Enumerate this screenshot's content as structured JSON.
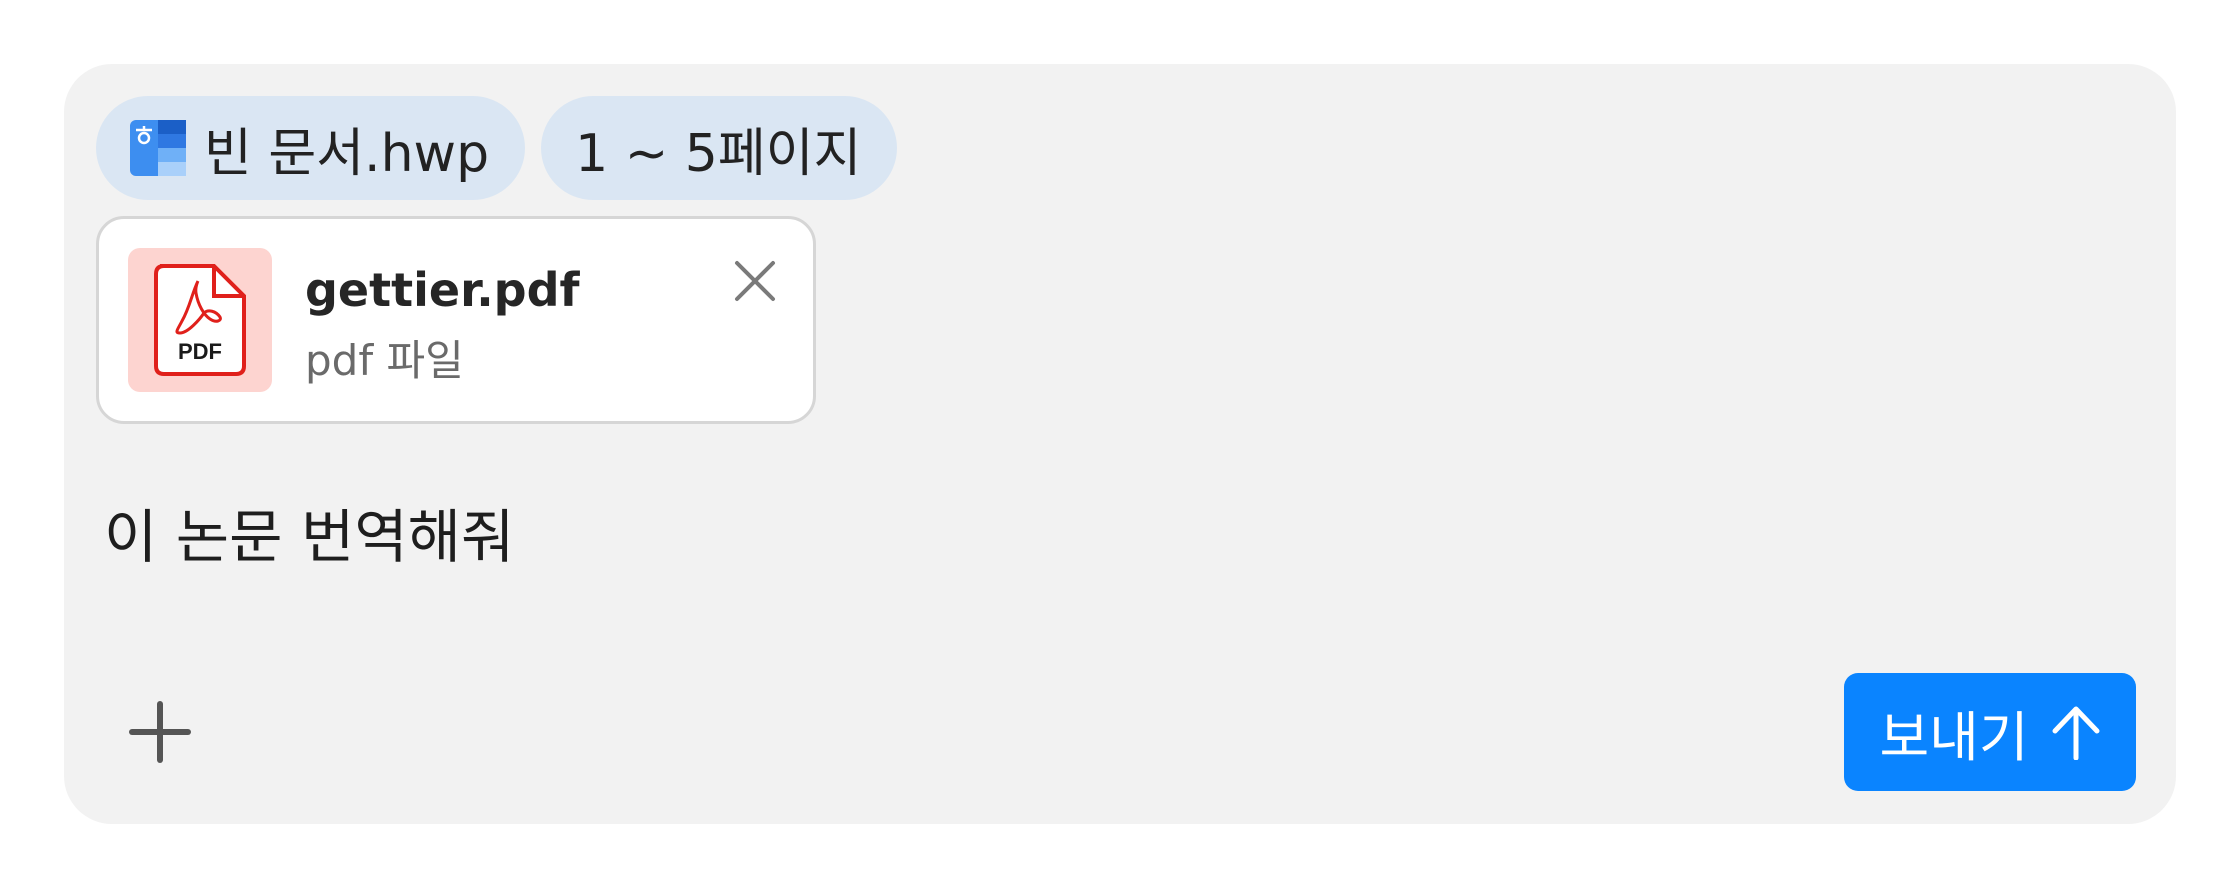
{
  "chips": [
    {
      "label": "빈 문서.hwp",
      "icon": "hwp-document-icon"
    },
    {
      "label": "1 ~ 5페이지"
    }
  ],
  "attachment": {
    "name": "gettier.pdf",
    "type_label": "pdf 파일",
    "icon": "pdf-file-icon",
    "icon_text": "PDF",
    "close_icon": "close-icon"
  },
  "message": {
    "text": "이 논문 번역해줘"
  },
  "toolbar": {
    "add_icon": "plus-icon",
    "send_label": "보내기",
    "send_icon": "arrow-up-icon"
  },
  "colors": {
    "composer_bg": "#f2f2f2",
    "chip_bg": "#dae6f3",
    "pdf_tile_bg": "#fdd4d0",
    "pdf_red": "#e0201b",
    "send_bg": "#0a84ff"
  }
}
